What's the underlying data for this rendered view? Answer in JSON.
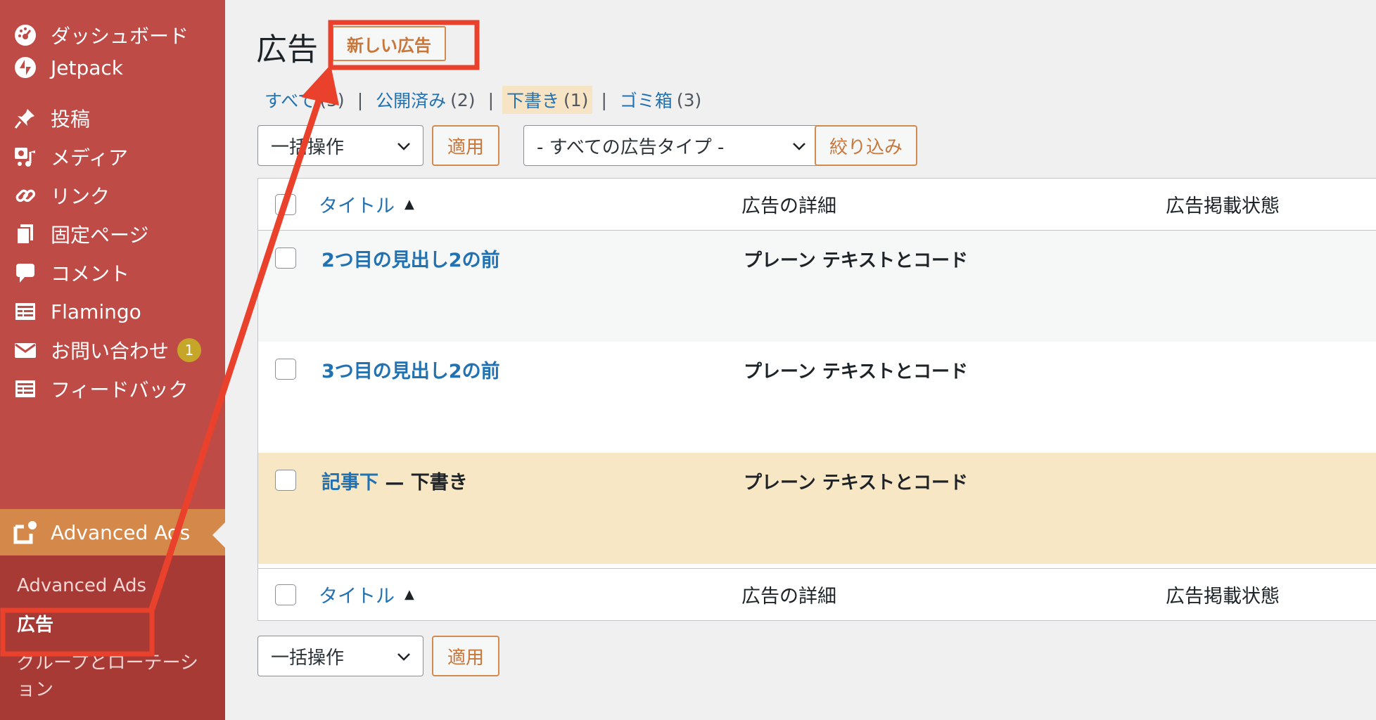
{
  "sidebar": {
    "items": [
      {
        "label": "ダッシュボード",
        "icon": "dashboard-icon"
      },
      {
        "label": "Jetpack",
        "icon": "jetpack-icon"
      },
      {
        "label": "投稿",
        "icon": "pin-icon"
      },
      {
        "label": "メディア",
        "icon": "media-icon"
      },
      {
        "label": "リンク",
        "icon": "link-icon"
      },
      {
        "label": "固定ページ",
        "icon": "page-icon"
      },
      {
        "label": "コメント",
        "icon": "comment-icon"
      },
      {
        "label": "Flamingo",
        "icon": "form-icon"
      },
      {
        "label": "お問い合わせ",
        "icon": "mail-icon",
        "badge": "1"
      },
      {
        "label": "フィードバック",
        "icon": "feedback-icon"
      },
      {
        "label": "Advanced Ads",
        "icon": "advanced-ads-icon",
        "active": true
      }
    ],
    "submenu": [
      {
        "label": "Advanced Ads"
      },
      {
        "label": "広告",
        "current": true
      },
      {
        "label": "グループとローテーション"
      }
    ]
  },
  "header": {
    "title": "広告",
    "add_new": "新しい広告"
  },
  "filters": [
    {
      "label": "すべて",
      "count": "(3)"
    },
    {
      "label": "公開済み",
      "count": "(2)"
    },
    {
      "label": "下書き",
      "count": "(1)",
      "current": true
    },
    {
      "label": "ゴミ箱",
      "count": "(3)"
    }
  ],
  "toolbar": {
    "bulk_action": "一括操作",
    "apply": "適用",
    "ad_type": "- すべての広告タイプ -",
    "filter": "絞り込み"
  },
  "table": {
    "columns": {
      "title": "タイトル",
      "sort_indicator": "▲",
      "details": "広告の詳細",
      "status": "広告掲載状態"
    },
    "rows": [
      {
        "title": "2つ目の見出し2の前",
        "state": "",
        "details": "プレーン テキストとコード"
      },
      {
        "title": "3つ目の見出し2の前",
        "state": "",
        "details": "プレーン テキストとコード"
      },
      {
        "title": "記事下",
        "state": " — 下書き",
        "details": "プレーン テキストとコード"
      }
    ]
  },
  "colors": {
    "sidebar_bg": "#bf4b47",
    "active_bg": "#d4884a",
    "submenu_bg": "#a83a36",
    "link": "#2271b1",
    "accent_button": "#c8763a",
    "annotation": "#e9412b"
  }
}
